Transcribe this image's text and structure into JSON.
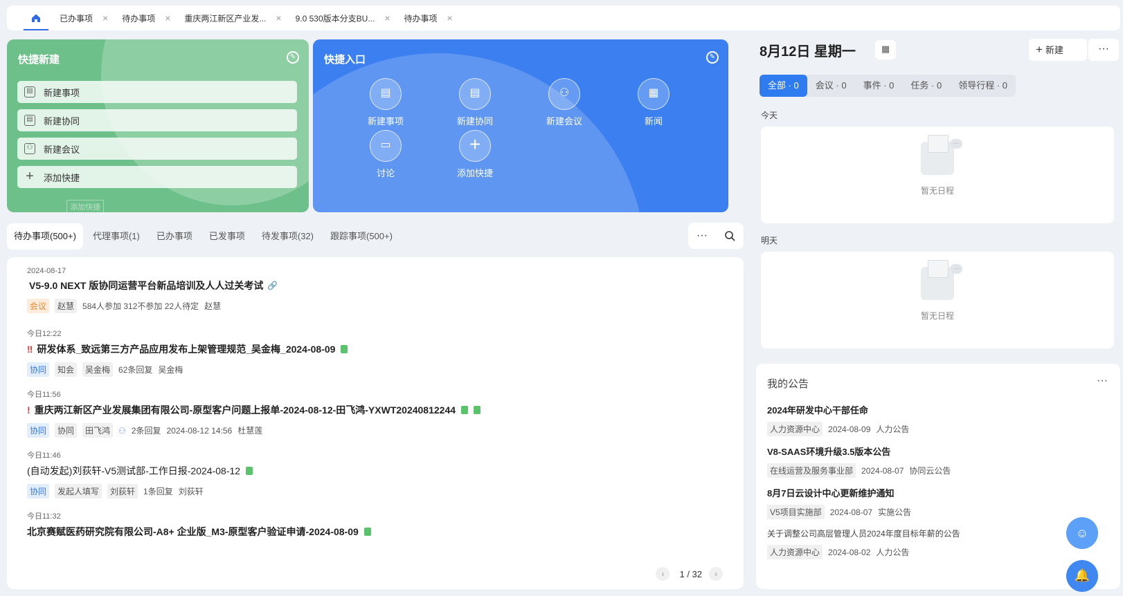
{
  "tabs": {
    "home_icon": "home-icon",
    "items": [
      {
        "label": "已办事项"
      },
      {
        "label": "待办事项"
      },
      {
        "label": "重庆两江新区产业发..."
      },
      {
        "label": "9.0 530版本分支BU..."
      },
      {
        "label": "待办事项"
      }
    ],
    "close_glyph": "×"
  },
  "quick_create": {
    "title": "快捷新建",
    "items": [
      {
        "label": "新建事项",
        "icon": "matter-icon"
      },
      {
        "label": "新建协同",
        "icon": "collab-icon"
      },
      {
        "label": "新建会议",
        "icon": "meeting-icon"
      },
      {
        "label": "添加快捷",
        "icon": "plus-icon"
      }
    ],
    "ghost": "添加快捷"
  },
  "quick_entry": {
    "title": "快捷入口",
    "items": [
      {
        "label": "新建事项"
      },
      {
        "label": "新建协同"
      },
      {
        "label": "新建会议"
      },
      {
        "label": "新闻"
      },
      {
        "label": "讨论"
      },
      {
        "label": "添加快捷"
      }
    ]
  },
  "todo_tabs": [
    {
      "label": "待办事项(500+)",
      "active": true
    },
    {
      "label": "代理事项(1)"
    },
    {
      "label": "已办事项"
    },
    {
      "label": "已发事项"
    },
    {
      "label": "待发事项(32)"
    },
    {
      "label": "跟踪事项(500+)"
    }
  ],
  "todo_tools": {
    "more": "···",
    "search_icon": "search-icon"
  },
  "todos": [
    {
      "time": "2024-08-17",
      "title": "V5-9.0 NEXT 版协同运营平台新品培训及人人过关考试",
      "tags": [
        "会议",
        "赵慧"
      ],
      "meta": [
        "584人参加 312不参加 22人待定",
        "赵慧"
      ]
    },
    {
      "time": "今日12:22",
      "title": "研发体系_致远第三方产品应用发布上架管理规范_吴金梅_2024-08-09",
      "tags": [
        "协同",
        "知会",
        "吴金梅"
      ],
      "meta": [
        "62条回复",
        "吴金梅"
      ]
    },
    {
      "time": "今日11:56",
      "title": "重庆两江新区产业发展集团有限公司-原型客户问题上报单-2024-08-12-田飞鸿-YXWT20240812244",
      "tags": [
        "协同",
        "协同",
        "田飞鸿"
      ],
      "meta": [
        "2条回复",
        "2024-08-12 14:56",
        "杜慧莲"
      ]
    },
    {
      "time": "今日11:46",
      "title": "(自动发起)刘荻轩-V5测试部-工作日报-2024-08-12",
      "tags": [
        "协同",
        "发起人填写",
        "刘荻轩"
      ],
      "meta": [
        "1条回复",
        "刘荻轩"
      ]
    },
    {
      "time": "今日11:32",
      "title": "北京赛赋医药研究院有限公司-A8+ 企业版_M3-原型客户验证申请-2024-08-09"
    }
  ],
  "pager": {
    "prev": "‹",
    "current": "1",
    "total": "/ 32",
    "next": "›"
  },
  "calendar": {
    "date_title": "8月12日 星期一",
    "new_label": "新建",
    "more": "···",
    "filters": [
      {
        "label": "全部 · 0",
        "active": true
      },
      {
        "label": "会议 · 0"
      },
      {
        "label": "事件 · 0"
      },
      {
        "label": "任务 · 0"
      },
      {
        "label": "领导行程 · 0"
      }
    ],
    "today_label": "今天",
    "tomorrow_label": "明天",
    "empty_text": "暂无日程"
  },
  "announcements": {
    "title": "我的公告",
    "more": "···",
    "items": [
      {
        "title": "2024年研发中心干部任命",
        "dept": "人力资源中心",
        "date": "2024-08-09",
        "type": "人力公告"
      },
      {
        "title": "V8-SAAS环境升级3.5版本公告",
        "dept": "在线运营及服务事业部",
        "date": "2024-08-07",
        "type": "协同云公告"
      },
      {
        "title": "8月7日云设计中心更新维护通知",
        "dept": "V5项目实施部",
        "date": "2024-08-07",
        "type": "实施公告"
      },
      {
        "title": "关于调整公司高层管理人员2024年度目标年薪的公告",
        "dept": "人力资源中心",
        "date": "2024-08-02",
        "type": "人力公告"
      }
    ]
  },
  "colors": {
    "green": "#6ec08a",
    "blue": "#3b7ff0",
    "accent": "#2f7bf0"
  }
}
